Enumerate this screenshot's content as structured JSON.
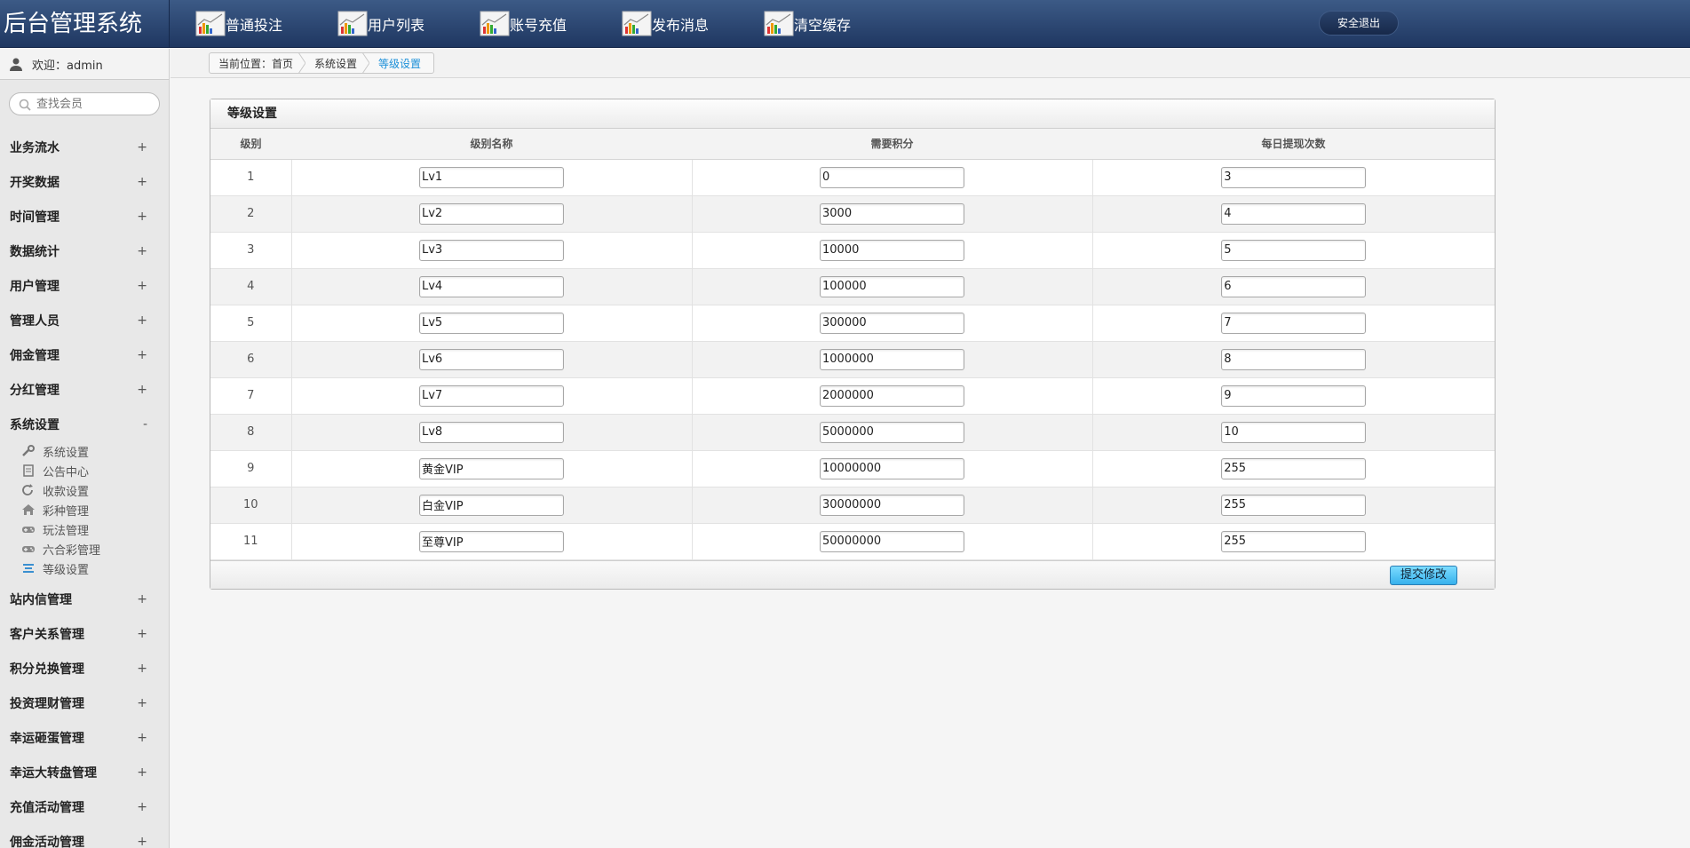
{
  "app": {
    "title": "后台管理系统"
  },
  "topnav": [
    {
      "label": "普通投注"
    },
    {
      "label": "用户列表"
    },
    {
      "label": "账号充值"
    },
    {
      "label": "发布消息"
    },
    {
      "label": "清空缓存"
    }
  ],
  "logout_label": "安全退出",
  "welcome": "欢迎：admin",
  "search": {
    "placeholder": "查找会员"
  },
  "menu": [
    {
      "label": "业务流水",
      "sign": "+"
    },
    {
      "label": "开奖数据",
      "sign": "+"
    },
    {
      "label": "时间管理",
      "sign": "+"
    },
    {
      "label": "数据统计",
      "sign": "+"
    },
    {
      "label": "用户管理",
      "sign": "+"
    },
    {
      "label": "管理人员",
      "sign": "+"
    },
    {
      "label": "佣金管理",
      "sign": "+"
    },
    {
      "label": "分红管理",
      "sign": "+"
    },
    {
      "label": "系统设置",
      "sign": "-"
    }
  ],
  "submenu": [
    {
      "label": "系统设置",
      "icon": "wrench-icon"
    },
    {
      "label": "公告中心",
      "icon": "document-icon"
    },
    {
      "label": "收款设置",
      "icon": "refresh-icon"
    },
    {
      "label": "彩种管理",
      "icon": "home-icon"
    },
    {
      "label": "玩法管理",
      "icon": "gamepad-icon"
    },
    {
      "label": "六合彩管理",
      "icon": "gamepad-icon"
    },
    {
      "label": "等级设置",
      "icon": "stack-icon"
    }
  ],
  "menu2": [
    {
      "label": "站内信管理",
      "sign": "+"
    },
    {
      "label": "客户关系管理",
      "sign": "+"
    },
    {
      "label": "积分兑换管理",
      "sign": "+"
    },
    {
      "label": "投资理财管理",
      "sign": "+"
    },
    {
      "label": "幸运砸蛋管理",
      "sign": "+"
    },
    {
      "label": "幸运大转盘管理",
      "sign": "+"
    },
    {
      "label": "充值活动管理",
      "sign": "+"
    },
    {
      "label": "佣金活动管理",
      "sign": "+"
    }
  ],
  "breadcrumb": {
    "prefix": "当前位置：首页",
    "parent": "系统设置",
    "current": "等级设置"
  },
  "panel": {
    "title": "等级设置",
    "columns": [
      "级别",
      "级别名称",
      "需要积分",
      "每日提现次数"
    ],
    "rows": [
      {
        "level": "1",
        "name": "Lv1",
        "points": "0",
        "withdraw": "3"
      },
      {
        "level": "2",
        "name": "Lv2",
        "points": "3000",
        "withdraw": "4"
      },
      {
        "level": "3",
        "name": "Lv3",
        "points": "10000",
        "withdraw": "5"
      },
      {
        "level": "4",
        "name": "Lv4",
        "points": "100000",
        "withdraw": "6"
      },
      {
        "level": "5",
        "name": "Lv5",
        "points": "300000",
        "withdraw": "7"
      },
      {
        "level": "6",
        "name": "Lv6",
        "points": "1000000",
        "withdraw": "8"
      },
      {
        "level": "7",
        "name": "Lv7",
        "points": "2000000",
        "withdraw": "9"
      },
      {
        "level": "8",
        "name": "Lv8",
        "points": "5000000",
        "withdraw": "10"
      },
      {
        "level": "9",
        "name": "黄金VIP",
        "points": "10000000",
        "withdraw": "255"
      },
      {
        "level": "10",
        "name": "白金VIP",
        "points": "30000000",
        "withdraw": "255"
      },
      {
        "level": "11",
        "name": "至尊VIP",
        "points": "50000000",
        "withdraw": "255"
      }
    ],
    "submit_label": "提交修改"
  },
  "colors": {
    "header": "#2b4571",
    "accent": "#1a8fd8",
    "button": "#49bdf0"
  }
}
